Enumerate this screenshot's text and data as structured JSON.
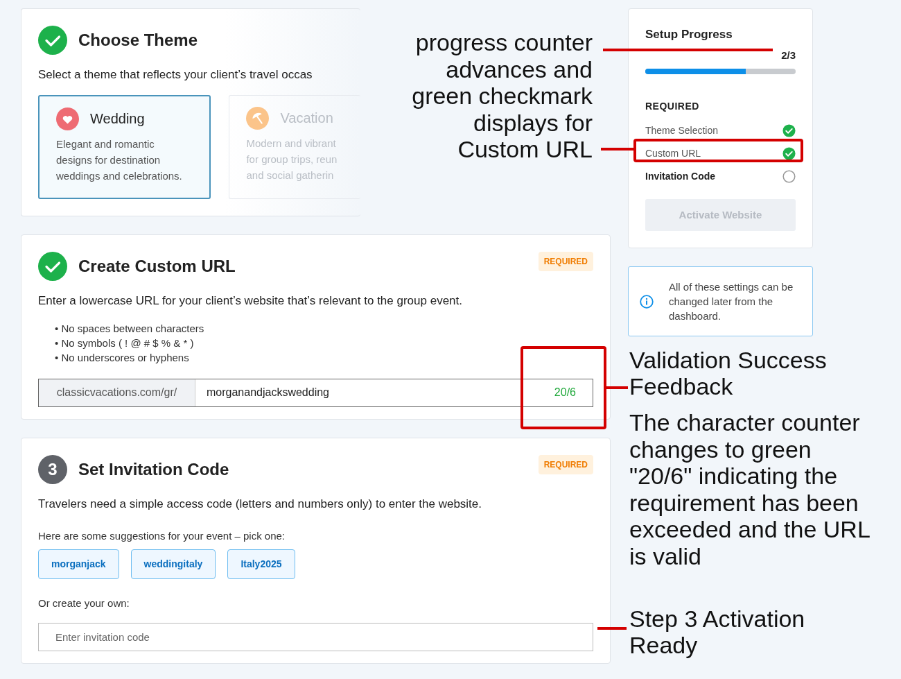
{
  "theme_step": {
    "title": "Choose Theme",
    "complete": true,
    "description": "Select a theme that reflects your client’s travel occas",
    "options": [
      {
        "kind": "wedding",
        "name": "Wedding",
        "lines": [
          "Elegant and romantic",
          "designs for destination",
          "weddings and celebrations."
        ],
        "selected": true
      },
      {
        "kind": "vacation",
        "name": "Vacation",
        "lines": [
          "Modern and vibrant",
          "for group trips, reun",
          "and social gatherin"
        ],
        "selected": false
      }
    ]
  },
  "url_step": {
    "title": "Create Custom URL",
    "complete": true,
    "badge": "REQUIRED",
    "description": "Enter a lowercase URL for your client’s website that’s relevant to the group event.",
    "rules": [
      "• No spaces between characters",
      "• No symbols ( ! @ # $ % & * )",
      "• No underscores or hyphens"
    ],
    "prefix": "classicvacations.com/gr/",
    "value": "morganandjackswedding",
    "counter": "20/6",
    "valid": true
  },
  "invite_step": {
    "number": "3",
    "title": "Set Invitation Code",
    "complete": false,
    "badge": "REQUIRED",
    "description": "Travelers need a simple access code (letters and numbers only) to enter the website.",
    "suggestions_label": "Here are some suggestions for your event – pick one:",
    "suggestions": [
      "morganjack",
      "weddingitaly",
      "Italy2025"
    ],
    "custom_label": "Or create your own:",
    "placeholder": "Enter invitation code"
  },
  "progress": {
    "title": "Setup Progress",
    "count": "2/3",
    "level": 0.67,
    "section": "REQUIRED",
    "items": [
      {
        "label": "Theme Selection",
        "done": true
      },
      {
        "label": "Custom URL",
        "done": true
      },
      {
        "label": "Invitation Code",
        "done": false
      }
    ],
    "button": {
      "label": "Activate Website",
      "disabled": true
    }
  },
  "info": {
    "text": "All of these settings can be changed later from the dashboard."
  },
  "annotations": [
    {
      "kind": "callout",
      "text": "progress counter advances and green checkmark displays for Custom URL"
    },
    {
      "kind": "heading",
      "text": "Validation Success Feedback"
    },
    {
      "kind": "note",
      "text": "The character counter changes to green \"20/6\" indicating the requirement has been exceeded and the URL is valid"
    },
    {
      "kind": "heading",
      "text": "Step 3 Activation Ready"
    }
  ]
}
